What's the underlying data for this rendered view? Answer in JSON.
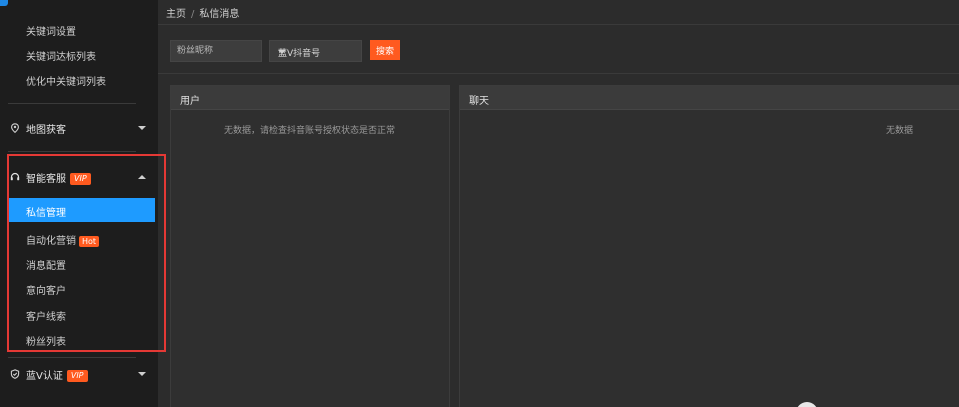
{
  "sidebar": {
    "sub_items_top": [
      "关键词设置",
      "关键词达标列表",
      "优化中关键词列表"
    ],
    "map_group": {
      "label": "地图获客"
    },
    "smart_group": {
      "label": "智能客服",
      "badge": "VIP"
    },
    "smart_items": [
      {
        "label": "私信管理",
        "active": true
      },
      {
        "label": "自动化营销",
        "badge": "Hot"
      },
      {
        "label": "消息配置"
      },
      {
        "label": "意向客户"
      },
      {
        "label": "客户线索"
      },
      {
        "label": "粉丝列表"
      }
    ],
    "blue_v_group": {
      "label": "蓝V认证",
      "badge": "VIP"
    }
  },
  "breadcrumb": {
    "home": "主页",
    "separator": "/",
    "current": "私信消息"
  },
  "filters": {
    "fan_nickname_placeholder": "粉丝昵称",
    "account_select_value": "蓝V抖音号",
    "search_label": "搜索"
  },
  "panels": {
    "users": {
      "title": "用户",
      "empty_text": "无数据，请检查抖音账号授权状态是否正常"
    },
    "chat": {
      "title": "聊天",
      "empty_text": "无数据"
    }
  },
  "colors": {
    "accent": "#1e9bff",
    "badge": "#ff5a1f",
    "highlight": "#e53935"
  }
}
